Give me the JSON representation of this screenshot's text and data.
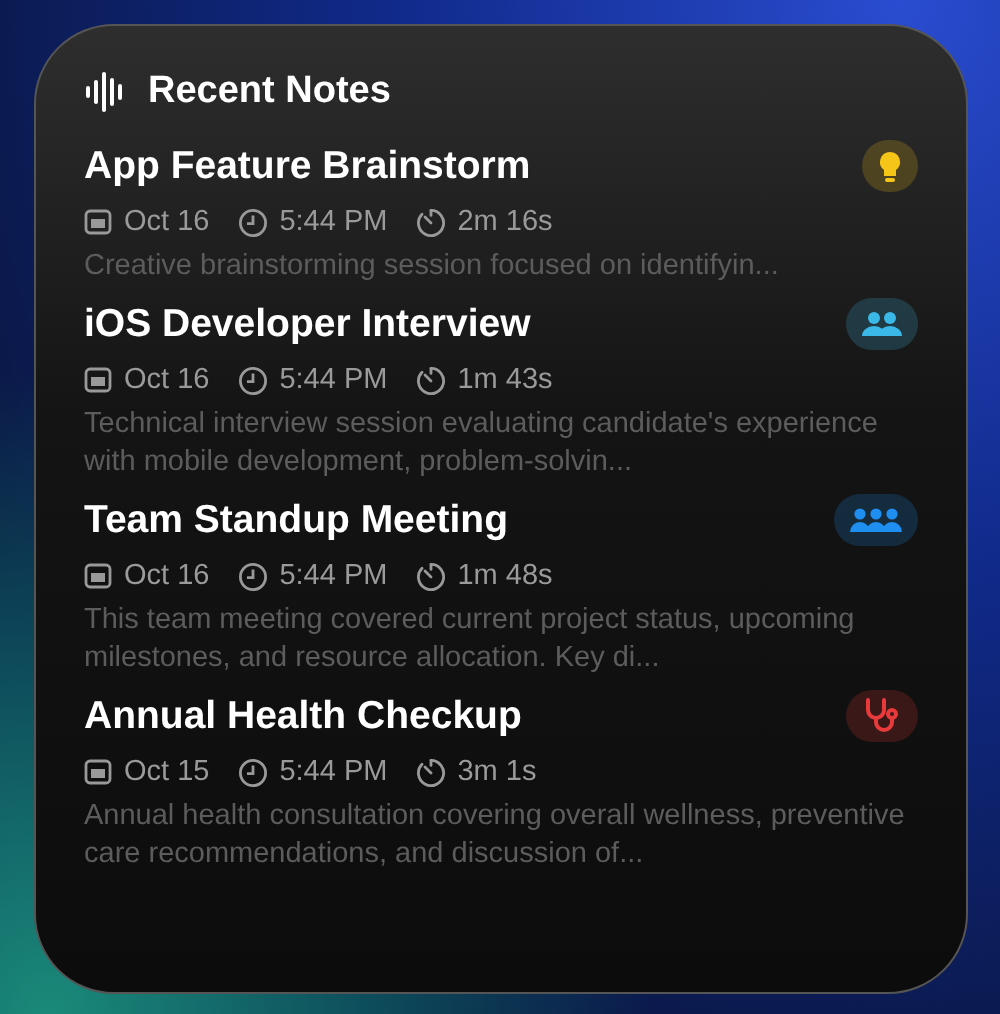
{
  "widget": {
    "title": "Recent Notes"
  },
  "notes": [
    {
      "title": "App Feature Brainstorm",
      "date": "Oct 16",
      "time": "5:44 PM",
      "duration": "2m 16s",
      "summary": "Creative brainstorming session focused on identifyin...",
      "kind": "idea",
      "color": "#f5c518"
    },
    {
      "title": "iOS Developer Interview",
      "date": "Oct 16",
      "time": "5:44 PM",
      "duration": "1m 43s",
      "summary": "Technical interview session evaluating candidate's experience with mobile development, problem-solvin...",
      "kind": "pair",
      "color": "#3ab8e8"
    },
    {
      "title": "Team Standup Meeting",
      "date": "Oct 16",
      "time": "5:44 PM",
      "duration": "1m 48s",
      "summary": "This team meeting covered current project status, upcoming milestones, and resource allocation. Key di...",
      "kind": "team",
      "color": "#1e8ff0"
    },
    {
      "title": "Annual Health Checkup",
      "date": "Oct 15",
      "time": "5:44 PM",
      "duration": "3m 1s",
      "summary": "Annual health consultation covering overall wellness, preventive care recommendations, and discussion of...",
      "kind": "health",
      "color": "#e83a3a"
    }
  ]
}
